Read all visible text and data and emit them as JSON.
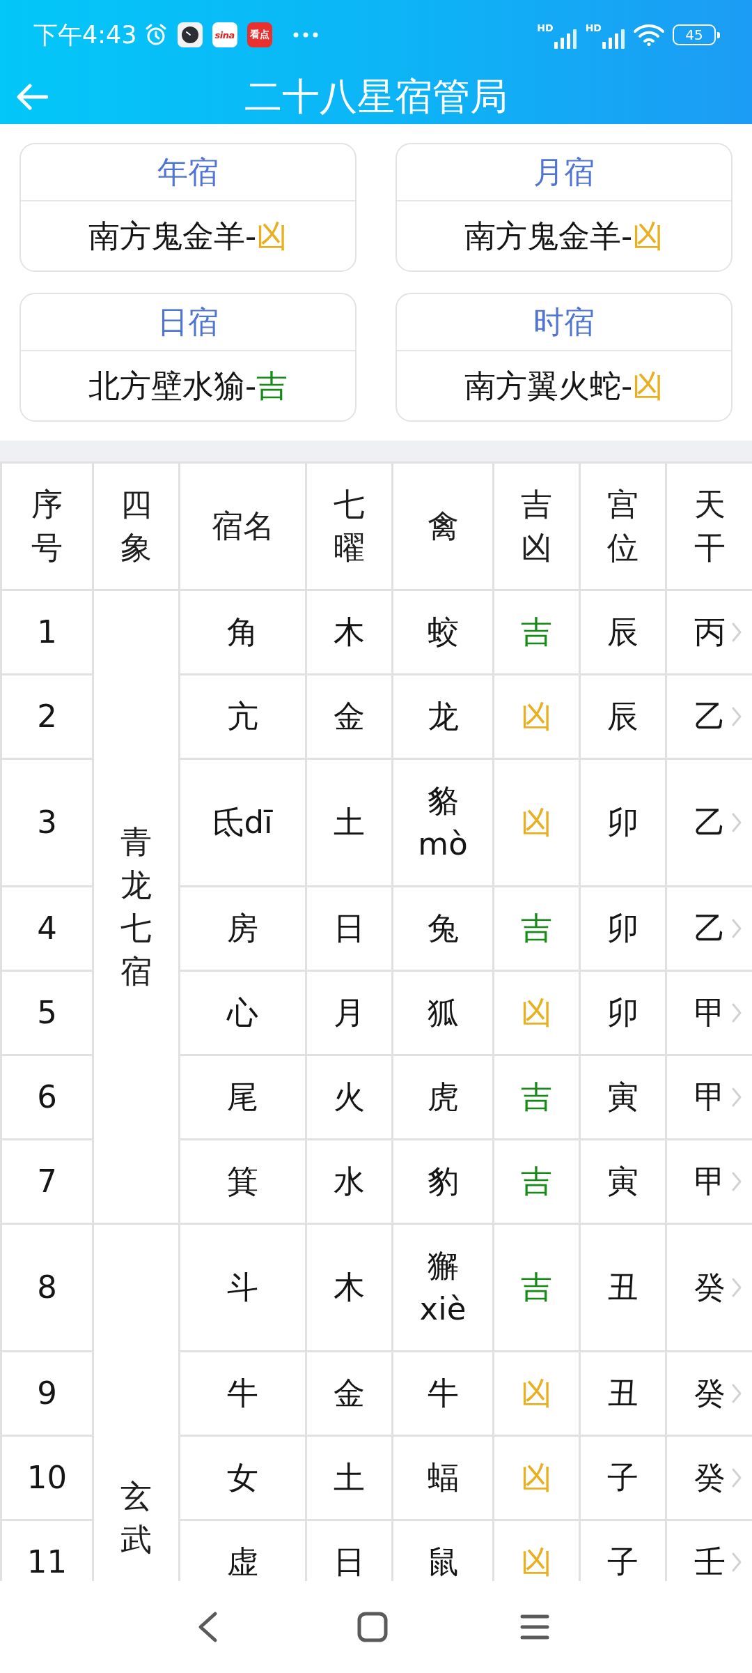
{
  "status_bar": {
    "time": "下午4:43",
    "notifications": [
      {
        "kind": "clock"
      },
      {
        "kind": "wordmark",
        "label": "sina"
      },
      {
        "kind": "badge",
        "label": "看点"
      }
    ],
    "signals": [
      {
        "label": "HD"
      },
      {
        "label": "HD"
      }
    ],
    "battery": "45"
  },
  "header": {
    "title": "二十八星宿管局"
  },
  "cards": [
    {
      "title": "年宿",
      "value": "南方鬼金羊-",
      "verdict": "凶",
      "color": "#e8b021"
    },
    {
      "title": "月宿",
      "value": "南方鬼金羊-",
      "verdict": "凶",
      "color": "#e8b021"
    },
    {
      "title": "日宿",
      "value": "北方壁水㺄-",
      "verdict": "吉",
      "color": "#168a16"
    },
    {
      "title": "时宿",
      "value": "南方翼火蛇-",
      "verdict": "凶",
      "color": "#e8b021"
    }
  ],
  "table": {
    "columns": [
      "序号",
      "四象",
      "宿名",
      "七曜",
      "禽",
      "吉凶",
      "宫位",
      "天干"
    ],
    "groups": [
      {
        "name": "青龙七宿",
        "rows": [
          {
            "no": "1",
            "mansion": "角",
            "planet": "木",
            "animal": "蛟",
            "verdict": "吉",
            "color": "#168a16",
            "palace": "辰",
            "stem": "丙"
          },
          {
            "no": "2",
            "mansion": "亢",
            "planet": "金",
            "animal": "龙",
            "verdict": "凶",
            "color": "#e8b021",
            "palace": "辰",
            "stem": "乙"
          },
          {
            "no": "3",
            "mansion": "氐dī",
            "planet": "土",
            "animal": "貉mò",
            "verdict": "凶",
            "color": "#e8b021",
            "palace": "卯",
            "stem": "乙"
          },
          {
            "no": "4",
            "mansion": "房",
            "planet": "日",
            "animal": "兔",
            "verdict": "吉",
            "color": "#168a16",
            "palace": "卯",
            "stem": "乙"
          },
          {
            "no": "5",
            "mansion": "心",
            "planet": "月",
            "animal": "狐",
            "verdict": "凶",
            "color": "#e8b021",
            "palace": "卯",
            "stem": "甲"
          },
          {
            "no": "6",
            "mansion": "尾",
            "planet": "火",
            "animal": "虎",
            "verdict": "吉",
            "color": "#168a16",
            "palace": "寅",
            "stem": "甲"
          },
          {
            "no": "7",
            "mansion": "箕",
            "planet": "水",
            "animal": "豹",
            "verdict": "吉",
            "color": "#168a16",
            "palace": "寅",
            "stem": "甲"
          }
        ]
      },
      {
        "name": "玄武",
        "rows": [
          {
            "no": "8",
            "mansion": "斗",
            "planet": "木",
            "animal": "獬xiè",
            "verdict": "吉",
            "color": "#168a16",
            "palace": "丑",
            "stem": "癸"
          },
          {
            "no": "9",
            "mansion": "牛",
            "planet": "金",
            "animal": "牛",
            "verdict": "凶",
            "color": "#e8b021",
            "palace": "丑",
            "stem": "癸"
          },
          {
            "no": "10",
            "mansion": "女",
            "planet": "土",
            "animal": "蝠",
            "verdict": "凶",
            "color": "#e8b021",
            "palace": "子",
            "stem": "癸"
          },
          {
            "no": "11",
            "mansion": "虚",
            "planet": "日",
            "animal": "鼠",
            "verdict": "凶",
            "color": "#e8b021",
            "palace": "子",
            "stem": "壬"
          }
        ]
      }
    ]
  }
}
